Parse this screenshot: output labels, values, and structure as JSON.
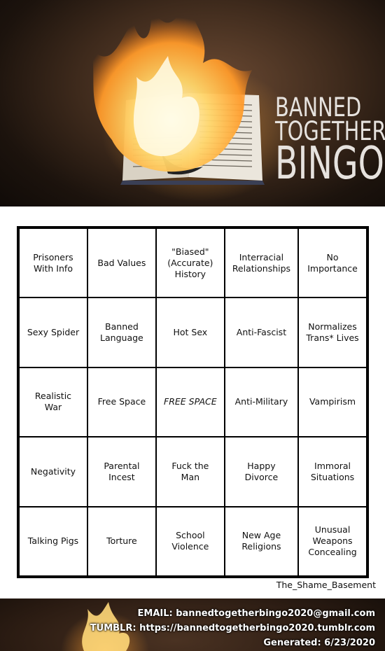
{
  "header": {
    "title_line1": "BANNED",
    "title_line2": "TOGETHER",
    "title_line3": "BINGO"
  },
  "board": {
    "rows": [
      [
        "Prisoners With Info",
        "Bad Values",
        "\"Biased\" (Accurate) History",
        "Interracial Relationships",
        "No Importance"
      ],
      [
        "Sexy Spider",
        "Banned Language",
        "Hot Sex",
        "Anti-Fascist",
        "Normalizes Trans* Lives"
      ],
      [
        "Realistic War",
        "Free Space",
        "FREE SPACE",
        "Anti-Military",
        "Vampirism"
      ],
      [
        "Negativity",
        "Parental Incest",
        "Fuck the Man",
        "Happy Divorce",
        "Immoral Situations"
      ],
      [
        "Talking Pigs",
        "Torture",
        "School Violence",
        "New Age Religions",
        "Unusual Weapons Concealing"
      ]
    ],
    "free_cell": [
      2,
      2
    ]
  },
  "author": "The_Shame_Basement",
  "footer": {
    "email": "EMAIL: bannedtogetherbingo2020@gmail.com",
    "tumblr": "TUMBLR: https://bannedtogetherbingo2020.tumblr.com",
    "generated": "Generated: 6/23/2020"
  },
  "colors": {
    "flame": "#ffb437",
    "title_text": "#e6e2de",
    "background_dark": "#2a1b12"
  }
}
